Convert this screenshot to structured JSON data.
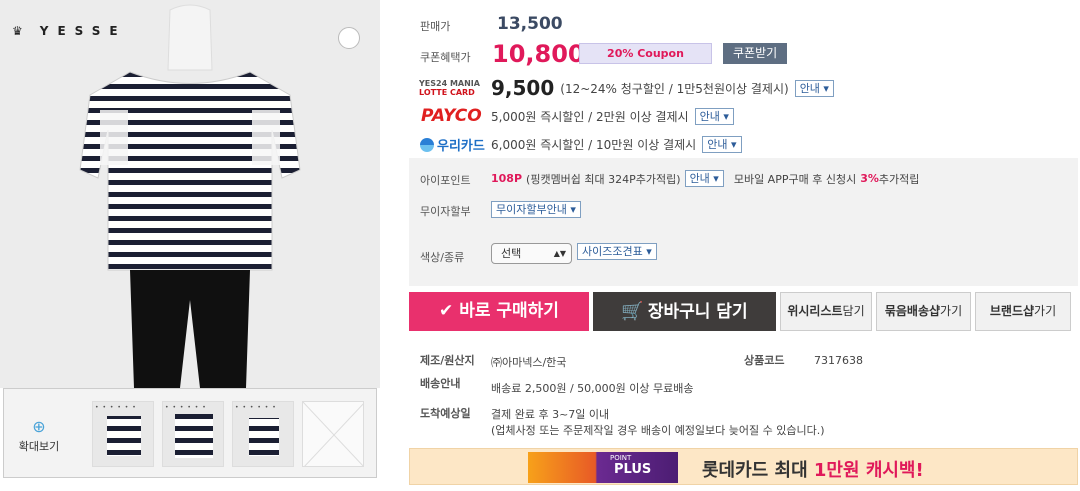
{
  "gallery": {
    "brand": "YESSE",
    "zoom_label": "확대보기",
    "thumb_dots": "• • • • • •"
  },
  "price": {
    "sale_label": "판매가",
    "sale_value": "13,500",
    "coupon_label": "쿠폰혜택가",
    "coupon_value": "10,800",
    "coupon_badge": "20% Coupon",
    "coupon_btn": "쿠폰받기"
  },
  "cards": {
    "lotte_logo_top": "YES24 MANIA",
    "lotte_logo_bottom": "LOTTE CARD",
    "lotte_price": "9,500",
    "lotte_desc": "(12~24% 청구할인 / 1만5천원이상 결제시)",
    "payco_logo": "PAYCO",
    "payco_desc": "5,000원 즉시할인 / 2만원 이상 결제시",
    "woori_logo": "우리카드",
    "woori_desc": "6,000원 즉시할인 / 10만원 이상 결제시",
    "guide_label": "안내 ▾"
  },
  "points": {
    "label": "아이포인트",
    "value": "108P",
    "desc": "(핑캣멤버쉽 최대 324P추가적립)",
    "guide": "안내 ▾",
    "mobile_text": "모바일 APP구매 후 신청시",
    "mobile_pct": "3%",
    "mobile_suffix": "추가적립"
  },
  "installment": {
    "label": "무이자할부",
    "btn": "무이자할부안내 ▾"
  },
  "option": {
    "label": "색상/종류",
    "select_value": "선택",
    "size_btn": "사이즈조견표 ▾"
  },
  "actions": {
    "buy": "✔ 바로 구매하기",
    "cart": "장바구니 담기",
    "wish_bold": "위시리스트",
    "wish_light": "담기",
    "bundle_bold": "묶음배송샵",
    "bundle_light": "가기",
    "brand_bold": "브랜드샵",
    "brand_light": "가기"
  },
  "details": {
    "origin_label": "제조/원산지",
    "origin_value": "㈜아마넥스/한국",
    "code_label": "상품코드",
    "code_value": "7317638",
    "ship_label": "배송안내",
    "ship_value": "배송료 2,500원 / 50,000원 이상 무료배송",
    "eta_label": "도착예상일",
    "eta_value1": "결제 완료 후 3~7일 이내",
    "eta_value2": "(업체사정 또는 주문제작일 경우 배송이 예정일보다 늦어질 수 있습니다.)"
  },
  "banner": {
    "logo_text": "PLUS",
    "logo_small": "POINT",
    "text_prefix": "롯데카드 최대 ",
    "text_highlight": "1만원 캐시백!"
  },
  "colors": {
    "accent_pink": "#e0195a",
    "price_blue": "#3b4a63",
    "cart_dark": "#3f3c3b"
  }
}
